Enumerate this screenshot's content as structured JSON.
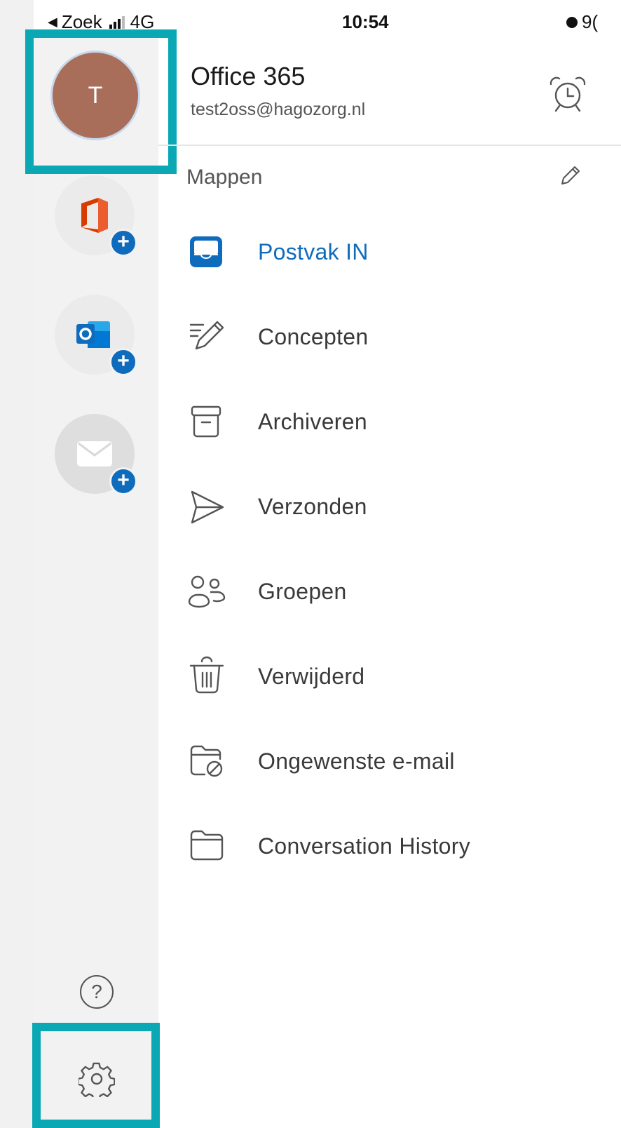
{
  "status_bar": {
    "back_label": "Zoek",
    "network": "4G",
    "time": "10:54",
    "battery_text": "9("
  },
  "account": {
    "initial": "T",
    "name": "Office 365",
    "email": "test2oss@hagozorg.nl",
    "avatar_color": "#a86e5a"
  },
  "rail_apps": [
    {
      "name": "office-app",
      "icon": "office-logo-icon"
    },
    {
      "name": "outlook-app",
      "icon": "outlook-logo-icon"
    },
    {
      "name": "mail-app",
      "icon": "mail-envelope-icon"
    }
  ],
  "section": {
    "title": "Mappen"
  },
  "folders": [
    {
      "label": "Postvak IN",
      "icon": "inbox-icon",
      "active": true
    },
    {
      "label": "Concepten",
      "icon": "drafts-pencil-icon",
      "active": false
    },
    {
      "label": "Archiveren",
      "icon": "archive-icon",
      "active": false
    },
    {
      "label": "Verzonden",
      "icon": "send-icon",
      "active": false
    },
    {
      "label": "Groepen",
      "icon": "groups-icon",
      "active": false
    },
    {
      "label": "Verwijderd",
      "icon": "trash-icon",
      "active": false
    },
    {
      "label": "Ongewenste e-mail",
      "icon": "junk-folder-icon",
      "active": false
    },
    {
      "label": "Conversation History",
      "icon": "folder-icon",
      "active": false
    }
  ],
  "colors": {
    "accent": "#0f6cbd",
    "highlight": "#0aa8b4"
  }
}
